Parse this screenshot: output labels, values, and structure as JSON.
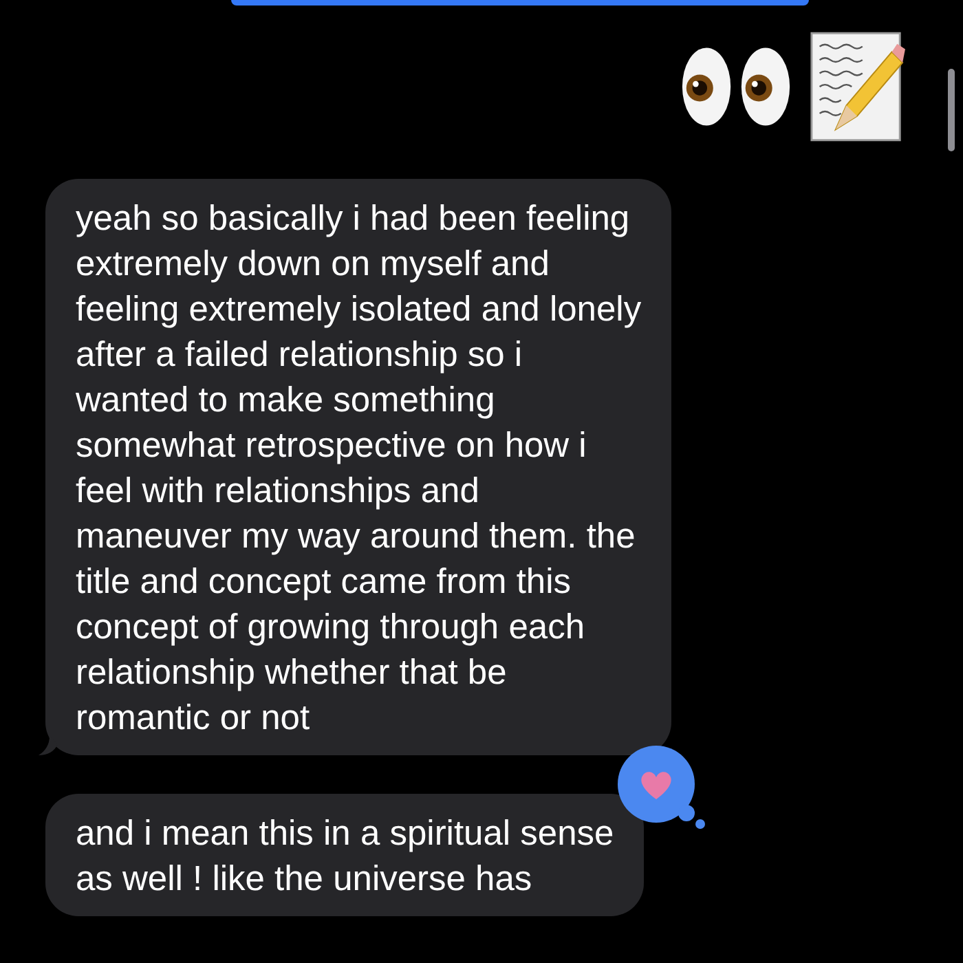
{
  "messages": [
    {
      "kind": "sent_edge"
    },
    {
      "kind": "emoji"
    },
    {
      "kind": "received",
      "tail": true,
      "lines": [
        "yeah so basically i had been feeling",
        "extremely down on myself and",
        "feeling extremely isolated and lonely",
        "after a failed relationship so i",
        "wanted to make something",
        "somewhat retrospective on how i",
        "feel with relationships and",
        "maneuver my way around them. the",
        "title and concept came from this",
        "concept of growing through each",
        "relationship whether that be",
        "romantic or not"
      ]
    },
    {
      "kind": "received",
      "tail": false,
      "heart_reaction": true,
      "lines": [
        "and i mean this in a spiritual sense",
        "as well ! like the universe has"
      ]
    }
  ]
}
